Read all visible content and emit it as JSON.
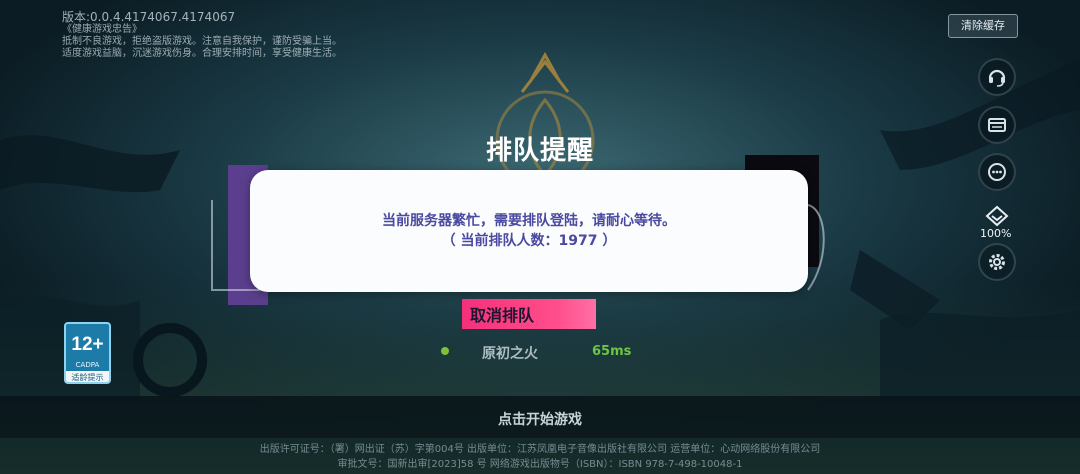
{
  "version": "版本:0.0.4.4174067.4174067",
  "health_notice": [
    "《健康游戏忠告》",
    "抵制不良游戏，拒绝盗版游戏。注意自我保护，谨防受骗上当。",
    "适度游戏益脑，沉迷游戏伤身。合理安排时间，享受健康生活。"
  ],
  "clear_cache_label": "清除缓存",
  "side_buttons": {
    "support_icon": "headset-icon",
    "notice_icon": "card-icon",
    "more_icon": "ellipsis-icon",
    "zoom_icon": "diamond-icon",
    "zoom_level": "100%",
    "settings_icon": "gear-icon"
  },
  "dialog": {
    "title": "排队提醒",
    "message": "当前服务器繁忙，需要排队登陆，请耐心等待。",
    "queue_count": "（ 当前排队人数：1977 ）"
  },
  "cancel_button": "取消排队",
  "server": {
    "name": "原初之火",
    "ping": "65ms",
    "status_color": "#7fbf3a"
  },
  "start_game": "点击开始游戏",
  "age_rating": {
    "number": "12+",
    "org": "CADPA",
    "tip": "适龄提示"
  },
  "footer": {
    "line1": "出版许可证号：（署）网出证（苏）字第004号    出版单位：江苏凤凰电子音像出版社有限公司    运营单位：心动网络股份有限公司",
    "line2": "审批文号：国新出审[2023]58 号    网络游戏出版物号（ISBN）：ISBN 978-7-498-10048-1"
  },
  "colors": {
    "accent_pink": "#f5307a",
    "dialog_text": "#4a4aa0",
    "ping_green": "#6ec444"
  }
}
